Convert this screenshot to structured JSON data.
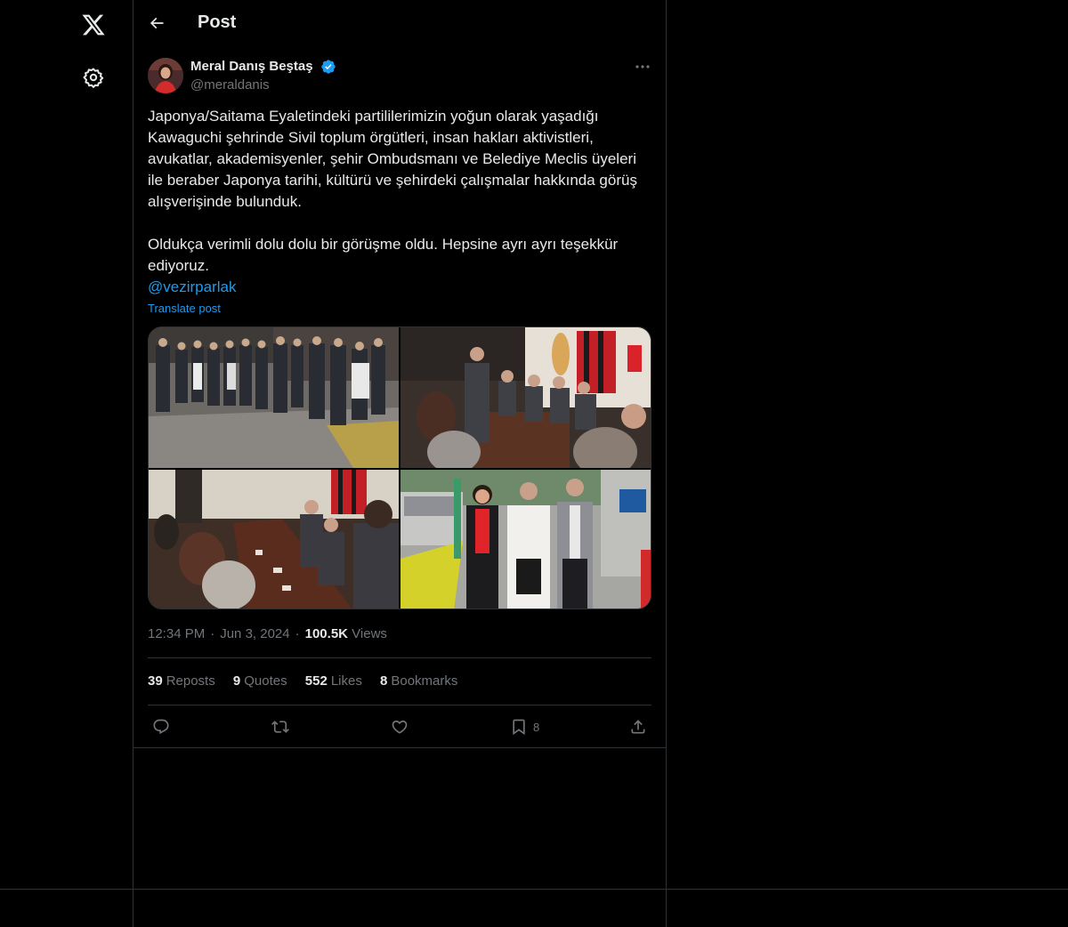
{
  "app": {
    "logo_icon": "x-logo-icon",
    "settings_icon": "gear-icon"
  },
  "header": {
    "title": "Post",
    "back_icon": "arrow-left-icon"
  },
  "author": {
    "name": "Meral Danış Beştaş",
    "handle": "@meraldanis",
    "verified": true,
    "verified_color": "#1d9bf0"
  },
  "tweet": {
    "paragraph1": "Japonya/Saitama Eyaletindeki partililerimizin yoğun olarak yaşadığı Kawaguchi şehrinde Sivil toplum örgütleri, insan hakları aktivistleri, avukatlar, akademisyenler, şehir Ombudsmanı ve Belediye Meclis üyeleri ile beraber Japonya tarihi, kültürü ve şehirdeki çalışmalar hakkında görüş alışverişinde bulunduk.",
    "paragraph2": "Oldukça verimli dolu dolu bir görüşme oldu. Hepsine ayrı ayrı teşekkür ediyoruz.",
    "mention": "@vezirparlak",
    "translate_label": "Translate post"
  },
  "meta": {
    "time": "12:34 PM",
    "date": "Jun 3, 2024",
    "views_count": "100.5K",
    "views_label": "Views",
    "separator": "·"
  },
  "stats": {
    "reposts_count": "39",
    "reposts_label": "Reposts",
    "quotes_count": "9",
    "quotes_label": "Quotes",
    "likes_count": "552",
    "likes_label": "Likes",
    "bookmarks_count": "8",
    "bookmarks_label": "Bookmarks"
  },
  "actions": {
    "reply_icon": "reply-icon",
    "repost_icon": "repost-icon",
    "like_icon": "heart-icon",
    "bookmark_icon": "bookmark-icon",
    "bookmark_count": "8",
    "share_icon": "share-icon"
  },
  "colors": {
    "background": "#000000",
    "text": "#e7e9ea",
    "secondary_text": "#71767b",
    "border": "#2f3336",
    "link": "#1d9bf0"
  }
}
